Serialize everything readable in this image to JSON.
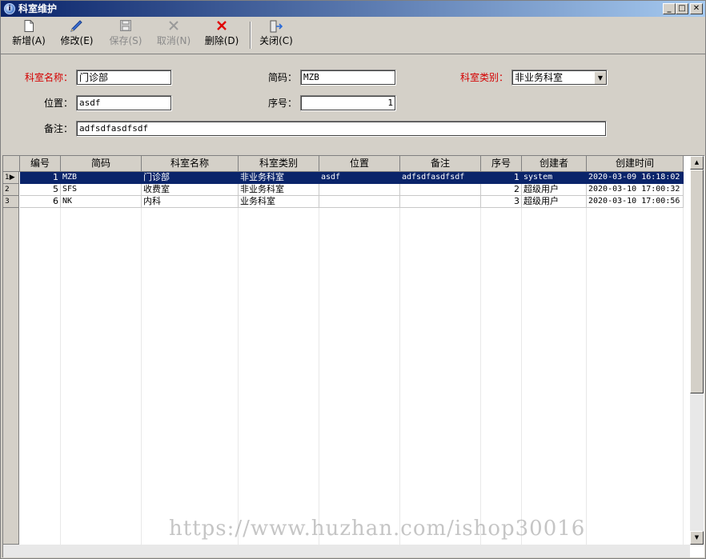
{
  "window": {
    "title": "科室维护",
    "minimize_glyph": "_",
    "maximize_glyph": "□",
    "close_glyph": "✕"
  },
  "toolbar": {
    "new_label": "新增(A)",
    "edit_label": "修改(E)",
    "save_label": "保存(S)",
    "cancel_label": "取消(N)",
    "delete_label": "删除(D)",
    "close_label": "关闭(C)",
    "icons": {
      "new": "new-document-icon",
      "edit": "pencil-icon",
      "save": "floppy-disk-icon",
      "cancel": "cancel-x-icon",
      "delete": "red-x-icon",
      "close": "exit-door-icon"
    }
  },
  "form": {
    "dept_name_label": "科室名称：",
    "dept_name_value": "门诊部",
    "short_code_label": "简码：",
    "short_code_value": "MZB",
    "dept_type_label": "科室类别：",
    "dept_type_value": "非业务科室",
    "location_label": "位置：",
    "location_value": "asdf",
    "seq_label": "序号：",
    "seq_value": "1",
    "remark_label": "备注：",
    "remark_value": "adfsdfasdfsdf"
  },
  "grid": {
    "columns": [
      "编号",
      "简码",
      "科室名称",
      "科室类别",
      "位置",
      "备注",
      "序号",
      "创建者",
      "创建时间"
    ],
    "rows": [
      {
        "row_no": "1",
        "id": "1",
        "code": "MZB",
        "name": "门诊部",
        "type": "非业务科室",
        "location": "asdf",
        "remark": "adfsdfasdfsdf",
        "seq": "1",
        "creator": "system",
        "created": "2020-03-09 16:18:02"
      },
      {
        "row_no": "2",
        "id": "5",
        "code": "SFS",
        "name": "收费室",
        "type": "非业务科室",
        "location": "",
        "remark": "",
        "seq": "2",
        "creator": "超级用户",
        "created": "2020-03-10 17:00:32"
      },
      {
        "row_no": "3",
        "id": "6",
        "code": "NK",
        "name": "内科",
        "type": "业务科室",
        "location": "",
        "remark": "",
        "seq": "3",
        "creator": "超级用户",
        "created": "2020-03-10 17:00:56"
      }
    ],
    "current_row_glyph": "▶"
  },
  "watermark": "https://www.huzhan.com/ishop30016",
  "colors": {
    "selection": "#0a246a",
    "required_label": "#d40000",
    "face": "#d4d0c8"
  }
}
